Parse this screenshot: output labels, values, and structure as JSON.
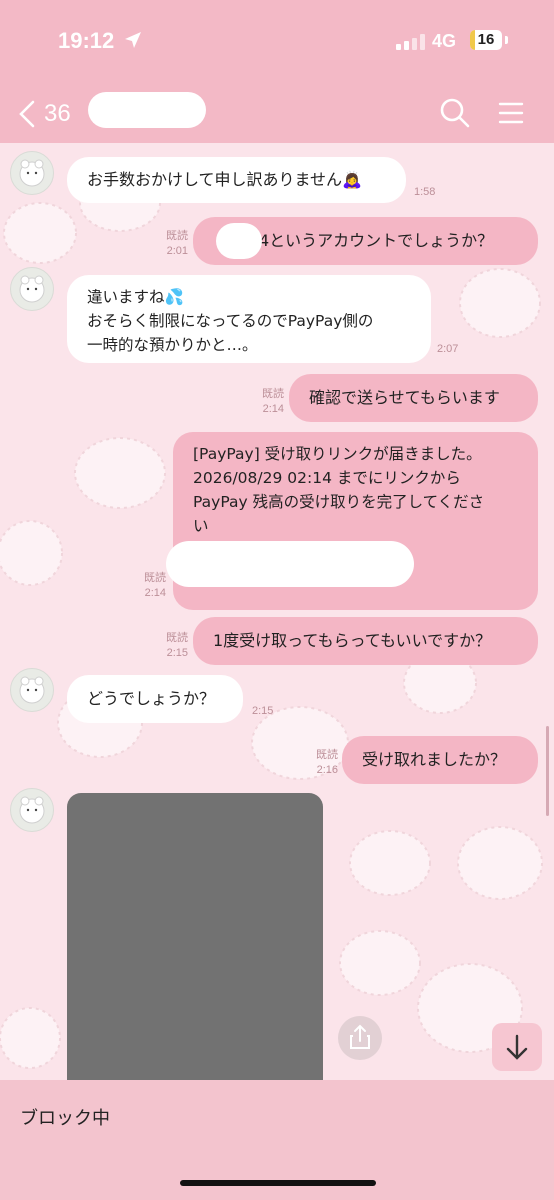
{
  "status_bar": {
    "time": "19:12",
    "network": "4G",
    "battery": "16"
  },
  "header": {
    "unread_count": "36"
  },
  "messages": [
    {
      "side": "in",
      "text": "お手数おかけして申し訳ありません🙇‍♀️",
      "time": "1:58"
    },
    {
      "side": "out",
      "text": "4というアカウントでしょうか？",
      "read": "既読",
      "time": "2:01"
    },
    {
      "side": "in",
      "lines": [
        "違いますね💦",
        "おそらく制限になってるのでPayPay側の",
        "一時的な預かりかと…。"
      ],
      "time": "2:07"
    },
    {
      "side": "out",
      "text": "確認で送らせてもらいます",
      "read": "既読",
      "time": "2:14"
    },
    {
      "side": "out",
      "lines": [
        "[PayPay] 受け取りリンクが届きました。",
        "2026/08/29 02:14 までにリンクから",
        "PayPay 残高の受け取りを完了してくださ",
        "い"
      ],
      "read": "既読",
      "time": "2:14"
    },
    {
      "side": "out",
      "text": "1度受け取ってもらってもいいですか？",
      "read": "既読",
      "time": "2:15"
    },
    {
      "side": "in",
      "text": "どうでしょうか？",
      "time": "2:15"
    },
    {
      "side": "out",
      "text": "受け取れましたか？",
      "read": "既読",
      "time": "2:16"
    }
  ],
  "footer": {
    "block_label": "ブロック中"
  },
  "colors": {
    "header": "#f3b9c6",
    "outgoing_bubble": "#f4b6c5",
    "incoming_bubble": "#ffffff",
    "chat_background": "#fbe4ea"
  }
}
